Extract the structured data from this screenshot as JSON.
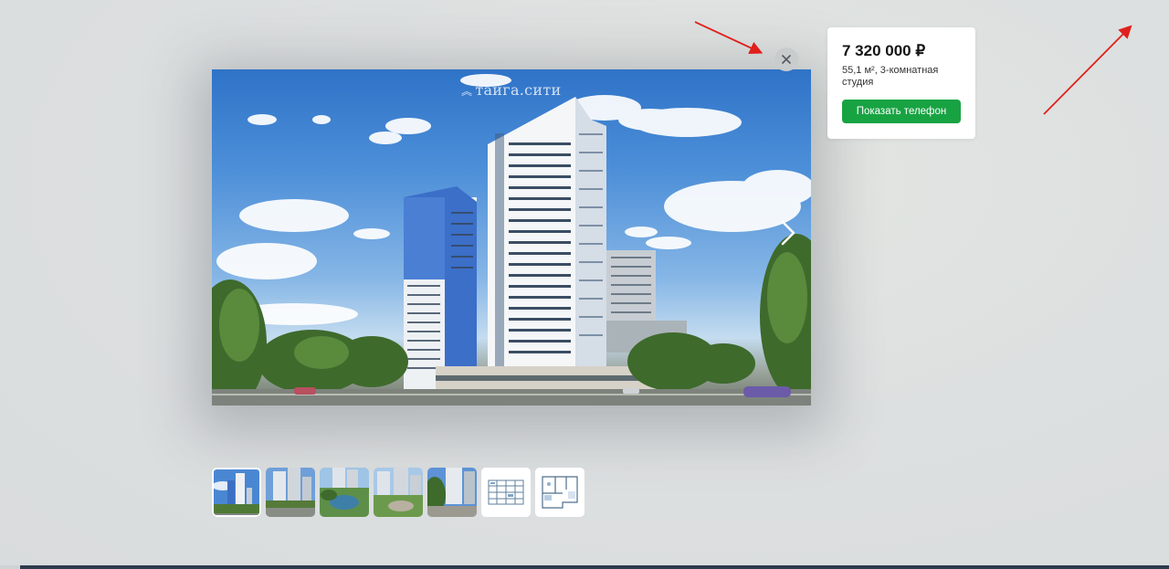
{
  "listing": {
    "price": "7 320 000 ₽",
    "description": "55,1 м², 3-комнатная студия",
    "show_phone_label": "Показать телефон"
  },
  "gallery": {
    "watermark": "тайга.сити",
    "thumbnails": [
      {
        "kind": "photo",
        "selected": true
      },
      {
        "kind": "photo",
        "selected": false
      },
      {
        "kind": "photo",
        "selected": false
      },
      {
        "kind": "photo",
        "selected": false
      },
      {
        "kind": "photo",
        "selected": false
      },
      {
        "kind": "floor-plan",
        "selected": false
      },
      {
        "kind": "floor-plan",
        "selected": false
      }
    ]
  },
  "icons": {
    "close": "close-icon",
    "next": "chevron-right-icon"
  },
  "colors": {
    "accent_button": "#18a343",
    "annotation_arrow": "#e0201c"
  }
}
